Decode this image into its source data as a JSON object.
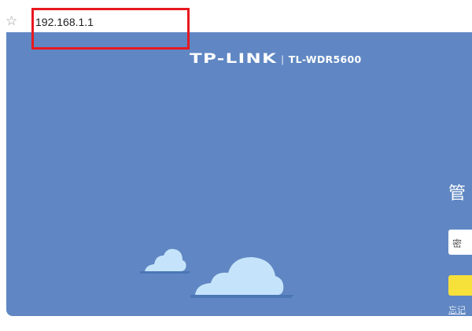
{
  "browser": {
    "url": "192.168.1.1",
    "star_icon": "☆"
  },
  "router": {
    "brand_logo": "TP-LINK",
    "brand_separator": "|",
    "model": "TL-WDR5600",
    "login_title_fragment": "管",
    "password_placeholder_fragment": "密",
    "forgot_link_fragment": "忘记"
  },
  "colors": {
    "page_background": "#6087c3",
    "login_button": "#f6e03a",
    "highlight": "#e8191f",
    "cloud": "#c5e4fb"
  }
}
